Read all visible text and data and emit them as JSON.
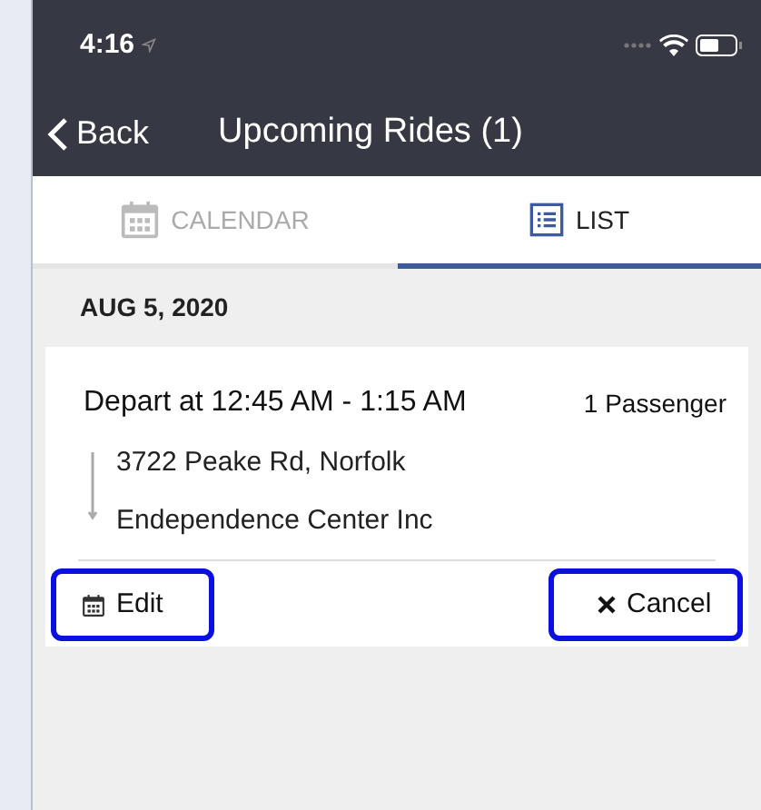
{
  "status_bar": {
    "time": "4:16"
  },
  "nav": {
    "back": "Back",
    "title": "Upcoming Rides (1)"
  },
  "tabs": [
    {
      "label": "CALENDAR",
      "kind": "calendar",
      "selected": false
    },
    {
      "label": "LIST",
      "kind": "list",
      "selected": true
    }
  ],
  "groups": [
    {
      "date": "AUG 5, 2020",
      "rides": [
        {
          "depart": "Depart at 12:45 AM - 1:15 AM",
          "passengers": "1 Passenger",
          "from": "3722 Peake Rd, Norfolk",
          "to": "Endependence Center Inc",
          "actions": [
            {
              "kind": "edit",
              "label": "Edit"
            },
            {
              "kind": "cancel",
              "label": "Cancel"
            }
          ]
        }
      ]
    }
  ]
}
